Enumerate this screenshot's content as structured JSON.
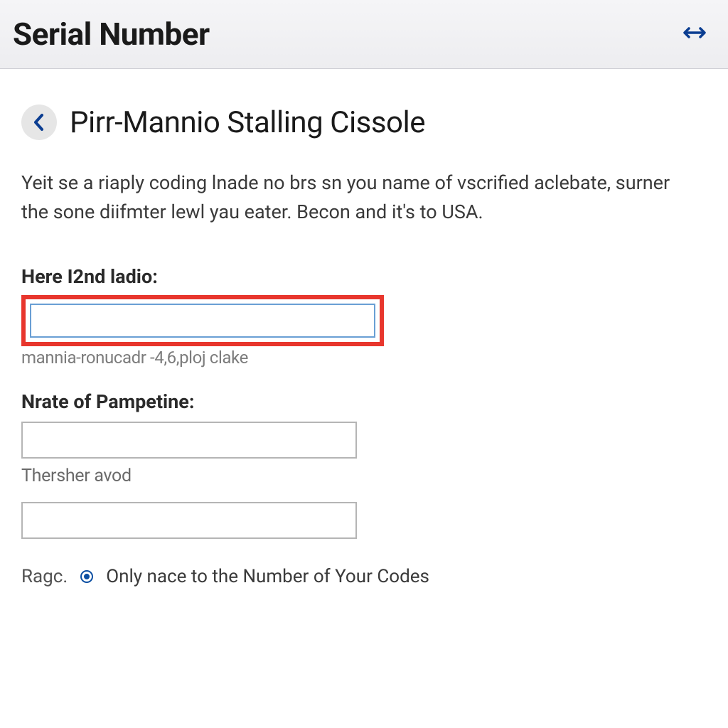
{
  "header": {
    "title": "Serial Number"
  },
  "page": {
    "title": "Pirr-Mannio Stalling Cissole",
    "description": "Yeit se a riaply coding lnade no brs sn you name of vscrified aclebate, surner the sone diifmter lewl yau eater. Becon and it's to USA."
  },
  "fields": {
    "first": {
      "label": "Here I2nd ladio:",
      "value": "",
      "help": "mannia-ronucadr -4,6,ploj clake"
    },
    "second": {
      "label": "Nrate of Pampetine:",
      "value": "",
      "help": "Thersher avod"
    },
    "third": {
      "value": ""
    }
  },
  "footer": {
    "link": "Ragc.",
    "info": "Only nace to the Number of Your Codes"
  }
}
